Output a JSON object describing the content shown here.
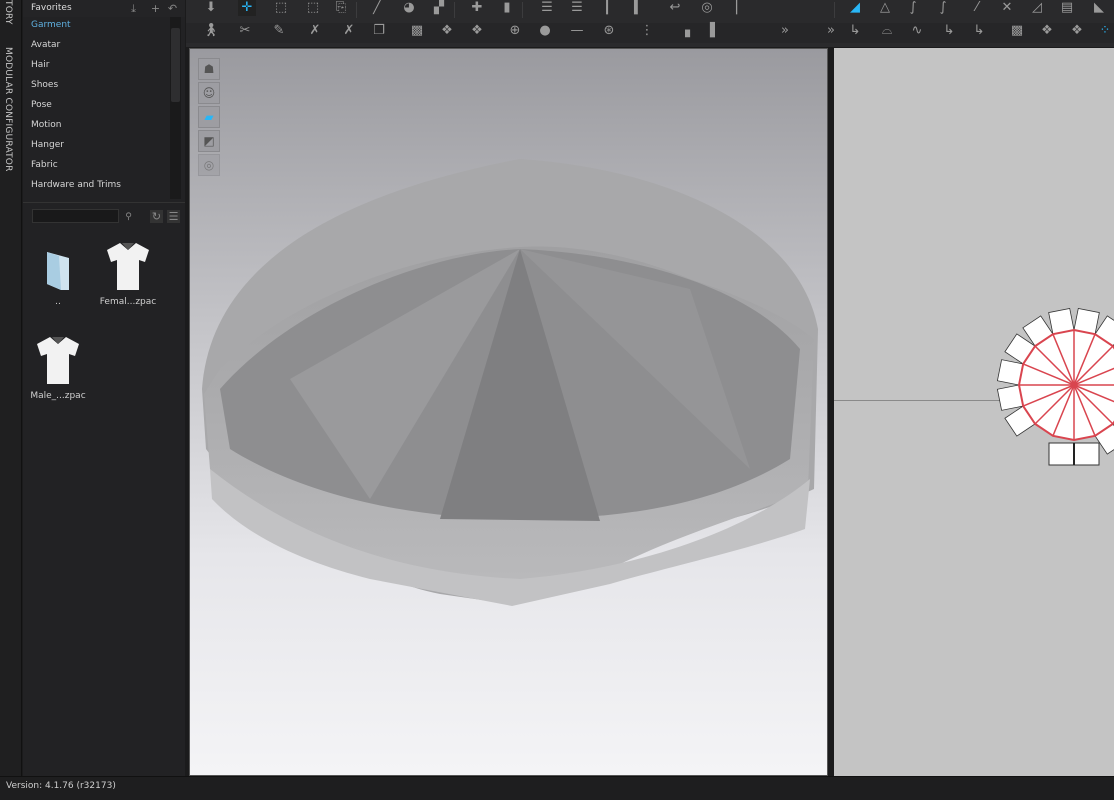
{
  "side_tabs": [
    "TORY",
    "MODULAR CONFIGURATOR"
  ],
  "library": {
    "header": "Favorites",
    "header_icons": [
      "download-icon",
      "add-icon",
      "back-icon"
    ],
    "categories": [
      "Garment",
      "Avatar",
      "Hair",
      "Shoes",
      "Pose",
      "Motion",
      "Hanger",
      "Fabric",
      "Hardware and Trims"
    ],
    "selected": "Garment",
    "search_placeholder": "",
    "files": [
      {
        "name": "..",
        "icon": "folder-icon"
      },
      {
        "name": "Femal...zpac",
        "icon": "tshirt-icon"
      },
      {
        "name": "Male_...zpac",
        "icon": "tshirt-icon"
      }
    ]
  },
  "colors": {
    "accent": "#29b6f6",
    "selected_text": "#5fb0e0",
    "seam": "#d9454f"
  },
  "status": {
    "version": "Version: 4.1.76 (r32173)"
  }
}
